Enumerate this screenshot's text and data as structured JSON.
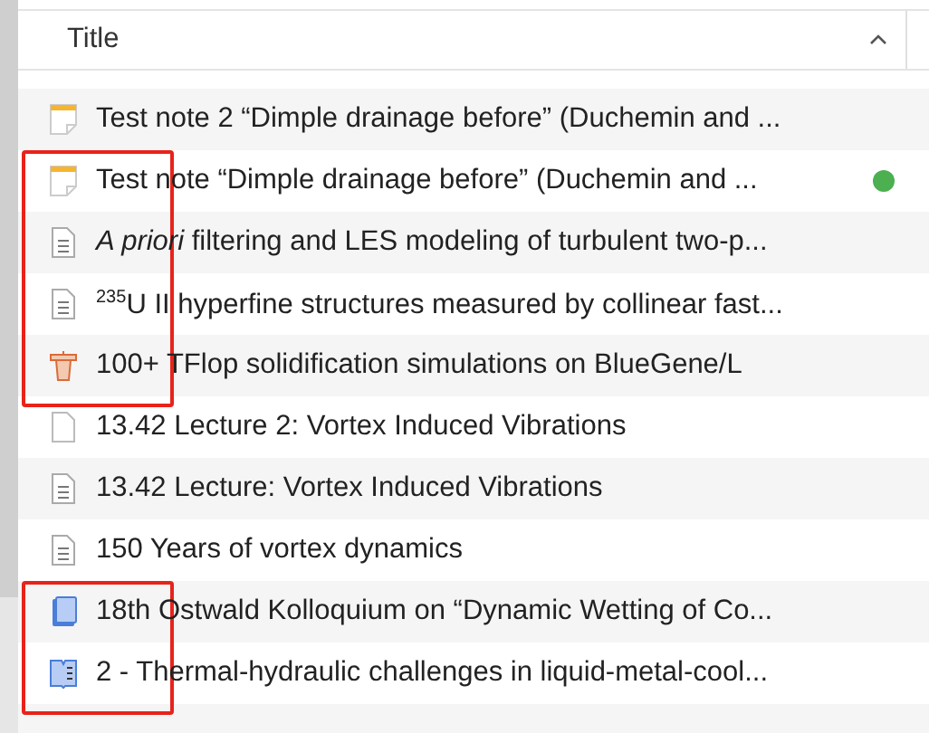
{
  "columns": [
    {
      "label": "Title",
      "sort_ascending": true
    }
  ],
  "rows": [
    {
      "kind": "note",
      "title": "Test note 2 “Dimple drainage before” (Duchemin and ..."
    },
    {
      "kind": "highlight_group",
      "children": [
        {
          "kind": "note",
          "title": "Test note “Dimple drainage before” (Duchemin and ...",
          "color": "#4caf50"
        },
        {
          "kind": "document",
          "title": "*A priori* filtering and LES modeling of turbulent two-p..."
        },
        {
          "kind": "document",
          "title": "$^{235}$U II hyperfine structures measured by collinear fast..."
        },
        {
          "kind": "presentation",
          "title": "100+ TFlop solidification simulations on BlueGene/L"
        }
      ]
    },
    {
      "kind": "blank",
      "title": "13.42 Lecture 2: Vortex Induced Vibrations"
    },
    {
      "kind": "document",
      "title": "13.42 Lecture: Vortex Induced Vibrations"
    },
    {
      "kind": "document",
      "title": "150 Years of vortex dynamics"
    },
    {
      "kind": "highlight_group",
      "children": [
        {
          "kind": "book",
          "title": "18th Ostwald Kolloquium on “Dynamic Wetting of Co..."
        },
        {
          "kind": "book_section",
          "title": "2 - Thermal-hydraulic challenges in liquid-metal-cool..."
        }
      ]
    }
  ]
}
